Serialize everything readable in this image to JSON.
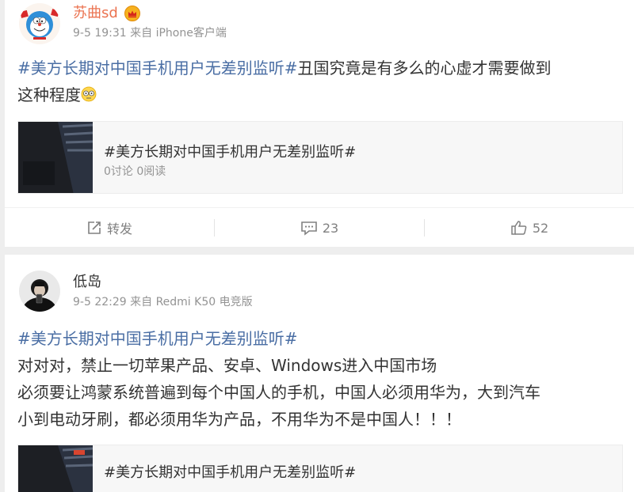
{
  "posts": [
    {
      "user": {
        "name": "苏曲sd"
      },
      "meta": {
        "date": "9-5 19:31",
        "source": "来自 iPhone客户端"
      },
      "text": {
        "hashtag": "#美方长期对中国手机用户无差别监听#",
        "line1_rest": "丑国究竟是有多么的心虚才需要做到",
        "line2": "这种程度"
      },
      "topic": {
        "title": "#美方长期对中国手机用户无差别监听#",
        "stats": "0讨论 0阅读"
      },
      "actions": {
        "repost_label": "转发",
        "comment_count": "23",
        "like_count": "52"
      }
    },
    {
      "user": {
        "name": "低岛"
      },
      "meta": {
        "date": "9-5 22:29",
        "source": "来自 Redmi K50 电竞版"
      },
      "text": {
        "hashtag": "#美方长期对中国手机用户无差别监听#",
        "line2": "对对对，禁止一切苹果产品、安卓、Windows进入中国市场",
        "line3": "必须要让鸿蒙系统普遍到每个中国人的手机，中国人必须用华为，大到汽车",
        "line4": "小到电动牙刷，都必须用华为产品，不用华为不是中国人！！！"
      },
      "topic": {
        "title": "#美方长期对中国手机用户无差别监听#"
      }
    }
  ],
  "icons": {
    "repost": "share-edit-icon",
    "comment": "comment-icon",
    "like": "thumbs-up-icon",
    "vip": "crown-badge-icon",
    "emoji": "clueless-emoji-icon"
  },
  "colors": {
    "hashtag": "#4a6ea4",
    "username_vip": "#eb7350",
    "meta": "#939393",
    "page_bg": "#eeeeee"
  }
}
